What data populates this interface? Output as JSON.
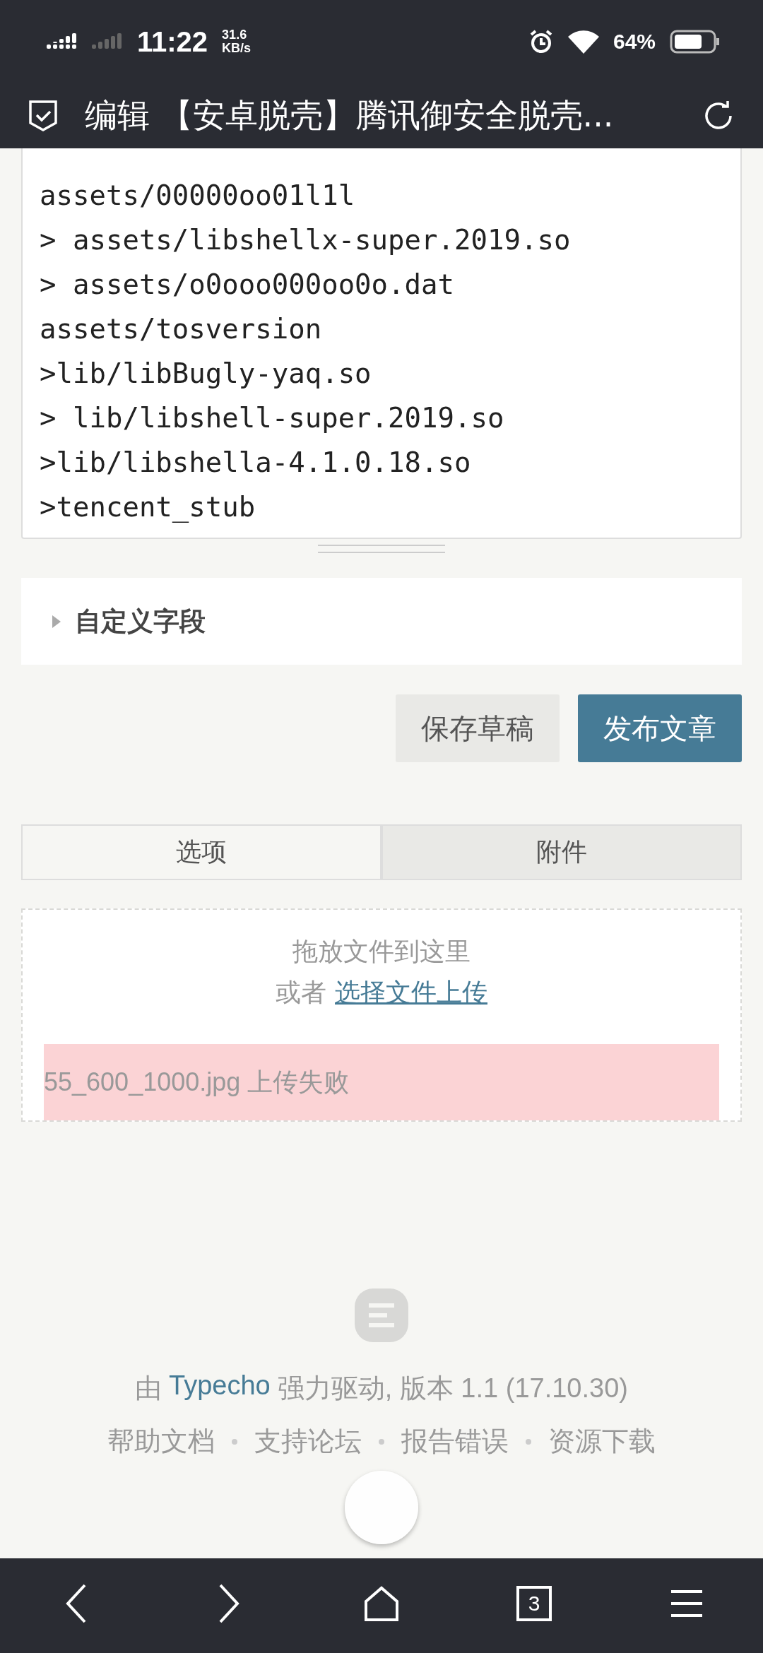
{
  "status_bar": {
    "time": "11:22",
    "speed_value": "31.6",
    "speed_unit": "KB/s",
    "battery": "64%"
  },
  "title_bar": {
    "title": "编辑 【安卓脱壳】腾讯御安全脱壳..."
  },
  "code_lines": [
    "assets/00000oo01l1l",
    "> assets/libshellx-super.2019.so",
    "> assets/o0ooo000oo0o.dat",
    "assets/tosversion",
    ">lib/libBugly-yaq.so",
    "> lib/libshell-super.2019.so",
    ">lib/libshella-4.1.0.18.so",
    ">tencent_stub"
  ],
  "custom_fields": {
    "label": "自定义字段",
    "expanded": false
  },
  "buttons": [
    {
      "label": "保存草稿",
      "kind": "secondary"
    },
    {
      "label": "发布文章",
      "kind": "primary"
    }
  ],
  "tabs": [
    {
      "label": "选项",
      "selected": true
    },
    {
      "label": "附件",
      "selected": false
    }
  ],
  "upload": {
    "hint": "拖放文件到这里",
    "or": "或者",
    "link": "选择文件上传",
    "error": "55_600_1000.jpg 上传失败"
  },
  "footer": {
    "prefix": "由",
    "brand": "Typecho",
    "suffix": "强力驱动, 版本 1.1 (17.10.30)",
    "links": [
      "帮助文档",
      "支持论坛",
      "报告错误",
      "资源下载"
    ]
  },
  "nav": {
    "tab_count": "3"
  }
}
